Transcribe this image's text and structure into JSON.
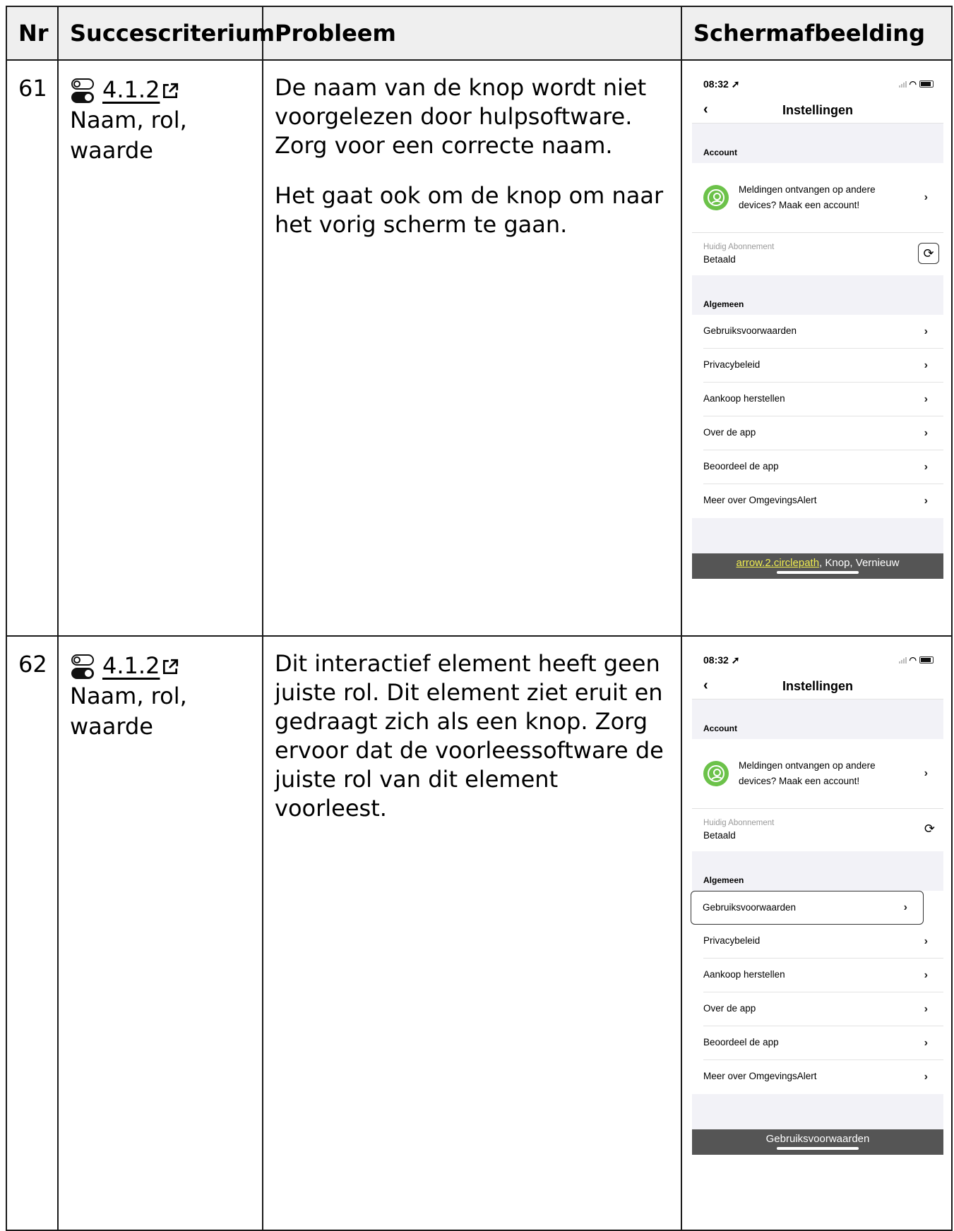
{
  "table": {
    "headers": {
      "nr": "Nr",
      "criterion": "Succescriterium",
      "problem": "Probleem",
      "screenshot": "Schermafbeelding"
    },
    "rows": [
      {
        "nr": "61",
        "criterion_link": "4.1.2",
        "criterion_name": "Naam, rol, waarde",
        "problem_paragraphs": [
          "De naam van de knop wordt niet voorgelezen door hulpsoftware. Zorg voor een correcte naam.",
          "Het gaat ook om de knop om naar het vorig scherm te gaan."
        ],
        "phone": {
          "time": "08:32",
          "nav_title": "Instellingen",
          "section_account": "Account",
          "account_text": "Meldingen ontvangen op andere devices? Maak een account!",
          "subscription_label": "Huidig Abonnement",
          "subscription_value": "Betaald",
          "section_general": "Algemeen",
          "items": [
            "Gebruiksvoorwaarden",
            "Privacybeleid",
            "Aankoop herstellen",
            "Over de app",
            "Beoordeel de app",
            "Meer over OmgevingsAlert"
          ],
          "voiceover_highlight": "arrow.2.circlepath",
          "voiceover_rest": ", Knop, Vernieuw"
        }
      },
      {
        "nr": "62",
        "criterion_link": "4.1.2",
        "criterion_name": "Naam, rol, waarde",
        "problem_paragraphs": [
          "Dit interactief element heeft geen juiste rol. Dit element ziet eruit en gedraagt zich als een knop. Zorg ervoor dat de voorleessoftware de juiste rol van dit element voorleest."
        ],
        "phone": {
          "time": "08:32",
          "nav_title": "Instellingen",
          "section_account": "Account",
          "account_text": "Meldingen ontvangen op andere devices? Maak een account!",
          "subscription_label": "Huidig Abonnement",
          "subscription_value": "Betaald",
          "section_general": "Algemeen",
          "items": [
            "Gebruiksvoorwaarden",
            "Privacybeleid",
            "Aankoop herstellen",
            "Over de app",
            "Beoordeel de app",
            "Meer over OmgevingsAlert"
          ],
          "voiceover_text": "Gebruiksvoorwaarden"
        }
      }
    ]
  },
  "icons": {
    "criterion_icon": "toggle-icon",
    "link_icon": "external-link-icon",
    "back_icon": "chevron-left-icon",
    "row_icon": "chevron-right-icon",
    "refresh_icon": "refresh-icon",
    "avatar_icon": "user-icon"
  },
  "colors": {
    "header_bg": "#efefef",
    "avatar_green": "#6cc24a",
    "voiceover_bar": "#555555",
    "voiceover_highlight": "#f0ed4f"
  }
}
